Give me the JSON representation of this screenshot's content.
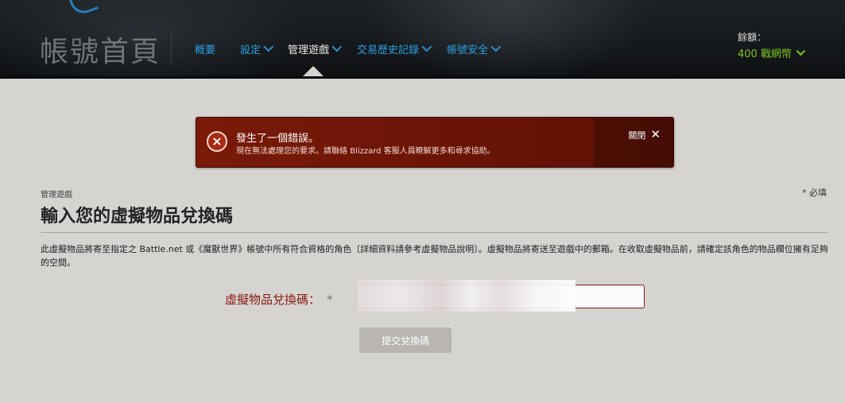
{
  "header": {
    "site_title": "帳號首頁",
    "nav": [
      {
        "label": "概要",
        "dropdown": false,
        "active": false
      },
      {
        "label": "設定",
        "dropdown": true,
        "active": false
      },
      {
        "label": "管理遊戲",
        "dropdown": true,
        "active": true
      },
      {
        "label": "交易歷史記錄",
        "dropdown": true,
        "active": false
      },
      {
        "label": "帳號安全",
        "dropdown": true,
        "active": false
      }
    ],
    "balance_label": "餘額：",
    "balance_value": "400 戰網幣"
  },
  "error": {
    "title": "發生了一個錯誤。",
    "message": "現在無法處理您的要求。請聯絡 Blizzard 客服人員瞭解更多和尋求協助。",
    "close_label": "關閉",
    "close_icon": "✕"
  },
  "content": {
    "breadcrumb": "管理遊戲",
    "required_note": "* 必填",
    "page_title": "輸入您的虛擬物品兌換碼",
    "description": "此虛擬物品將寄至指定之 Battle.net 或《魔獸世界》帳號中所有符合資格的角色〔詳細資料請參考虛擬物品說明〕。虛擬物品將寄送至遊戲中的郵箱。在收取虛擬物品前，請確定該角色的物品欄位擁有足夠的空間。",
    "field_label": "虛擬物品兌換碼：",
    "field_required_mark": "*",
    "code_value": "",
    "submit_label": "提交兌換碼"
  },
  "colors": {
    "nav_link": "#2a9fe0",
    "balance": "#7cc324",
    "error_bg": "#6a1406",
    "field_label": "#8b1a10"
  }
}
